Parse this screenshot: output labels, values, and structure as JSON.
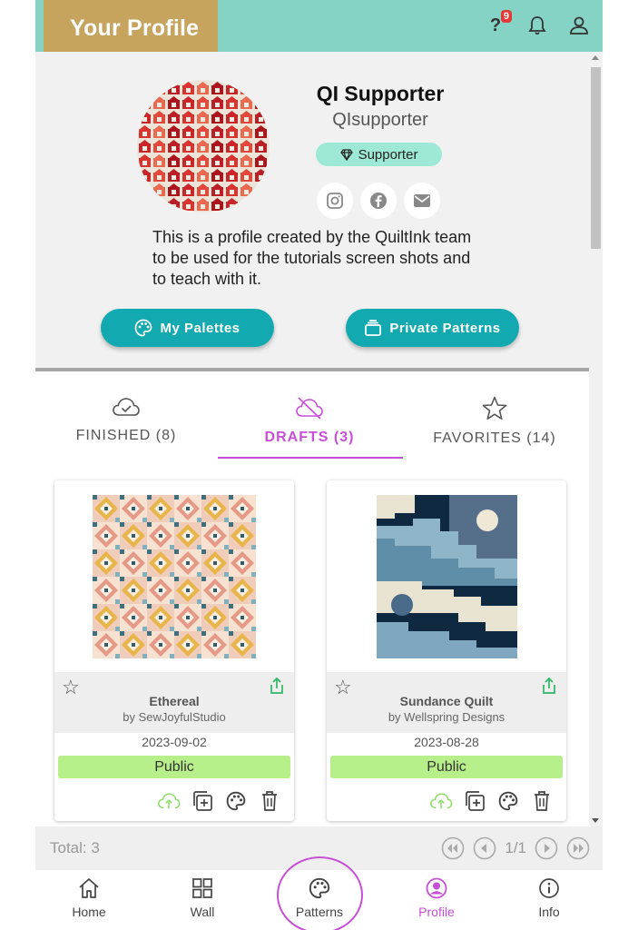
{
  "header": {
    "title": "Your Profile",
    "help_symbol": "?",
    "notification_count": "9"
  },
  "profile": {
    "display_name": "QI Supporter",
    "username": "QIsupporter",
    "badge_label": "Supporter",
    "bio": "This is a profile created by the QuiltInk team to be used for the tutorials screen shots and to teach with it.",
    "social_icons": [
      "instagram-icon",
      "facebook-icon",
      "email-icon"
    ],
    "buttons": {
      "palettes": "My Palettes",
      "private": "Private Patterns"
    }
  },
  "tabs": [
    {
      "label": "FINISHED (8)",
      "icon": "cloud-check-icon",
      "active": false
    },
    {
      "label": "DRAFTS (3)",
      "icon": "cloud-off-icon",
      "active": true
    },
    {
      "label": "FAVORITES (14)",
      "icon": "star-outline-icon",
      "active": false
    }
  ],
  "cards": [
    {
      "name": "Ethereal",
      "author": "by SewJoyfulStudio",
      "date": "2023-09-02",
      "status": "Public"
    },
    {
      "name": "Sundance Quilt",
      "author": "by Wellspring Designs",
      "date": "2023-08-28",
      "status": "Public"
    }
  ],
  "footer": {
    "total": "Total: 3",
    "page": "1/1"
  },
  "nav": [
    {
      "label": "Home",
      "icon": "home-icon"
    },
    {
      "label": "Wall",
      "icon": "grid-icon"
    },
    {
      "label": "Patterns",
      "icon": "palette-icon"
    },
    {
      "label": "Profile",
      "icon": "profile-icon",
      "active": true
    },
    {
      "label": "Info",
      "icon": "info-icon"
    }
  ],
  "colors": {
    "header_bg": "#84d3c5",
    "title_bg": "#c6a45d",
    "accent_teal": "#13a9b1",
    "accent_purple": "#c74fd8",
    "public_green": "#b7f08a",
    "supporter_badge": "#9ee9d5"
  }
}
